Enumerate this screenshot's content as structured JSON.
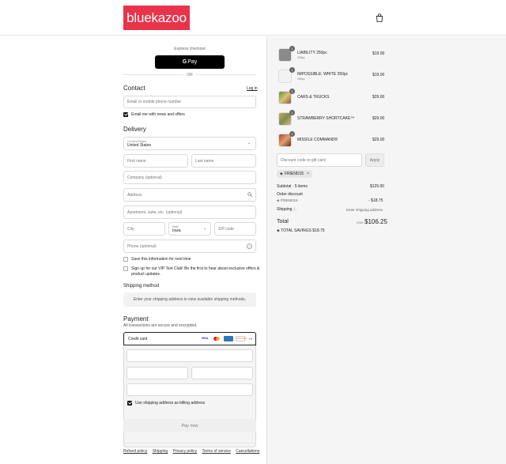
{
  "brand": {
    "logo_text": "bluekazoo",
    "accent": "#e8334a"
  },
  "express": {
    "label": "Express checkout",
    "button_label": "Pay",
    "or_label": "OR"
  },
  "contact": {
    "title": "Contact",
    "login_label": "Log in",
    "email_placeholder": "Email or mobile phone number",
    "news_label": "Email me with news and offers"
  },
  "delivery": {
    "title": "Delivery",
    "country_label": "Country/Region",
    "country_value": "United States",
    "first_name": "First name",
    "last_name": "Last name",
    "company": "Company (optional)",
    "address": "Address",
    "apartment": "Apartment, suite, etc. (optional)",
    "city": "City",
    "state_label": "State",
    "state_value": "Iowa",
    "zip": "ZIP code",
    "phone": "Phone (optional)",
    "save_info_label": "Save this information for next time",
    "vip_label_line1": "Sign up for our VIP Text Club! Be the first to hear about exclusive offers &",
    "vip_label_line2": "product updates."
  },
  "shipping_method": {
    "title": "Shipping method",
    "message": "Enter your shipping address to view available shipping methods."
  },
  "payment": {
    "title": "Payment",
    "subtitle": "All transactions are secure and encrypted.",
    "credit_card_label": "Credit card",
    "card_brands": [
      "VISA",
      "MC",
      "AMEX",
      "DISCOVER"
    ],
    "more_cards": "+3",
    "billing_label": "Use shipping address as billing address",
    "pay_button": "Pay now"
  },
  "footer": {
    "links": [
      "Refund policy",
      "Shipping",
      "Privacy policy",
      "Terms of service",
      "Cancellations"
    ]
  },
  "order": {
    "items": [
      {
        "name": "LIABILITY 250pc",
        "variant": "250pc",
        "qty": "1",
        "price": "$19.00"
      },
      {
        "name": "IMPOSSIBLE: WHITE 250pc",
        "variant": "250pc",
        "qty": "1",
        "price": "$19.00"
      },
      {
        "name": "CARS & TRUCKS",
        "variant": "",
        "qty": "1",
        "price": "$29.00"
      },
      {
        "name": "STRAWBERRY SHORTCAKE™",
        "variant": "",
        "qty": "1",
        "price": "$29.00"
      },
      {
        "name": "MISSILE COMMAND®",
        "variant": "",
        "qty": "1",
        "price": "$29.00"
      }
    ],
    "discount_placeholder": "Discount code or gift card",
    "apply_label": "Apply",
    "discount_tag": "FRIEND15",
    "subtotal_label": "Subtotal · 5 items",
    "subtotal_value": "$125.00",
    "order_discount_label": "Order discount",
    "order_discount_code": "FRIEND15",
    "order_discount_value": "- $18.75",
    "shipping_label": "Shipping",
    "shipping_value": "Enter shipping address",
    "total_label": "Total",
    "currency": "USD",
    "total_value": "$106.25",
    "savings_label": "TOTAL SAVINGS",
    "savings_value": "$18.75"
  }
}
